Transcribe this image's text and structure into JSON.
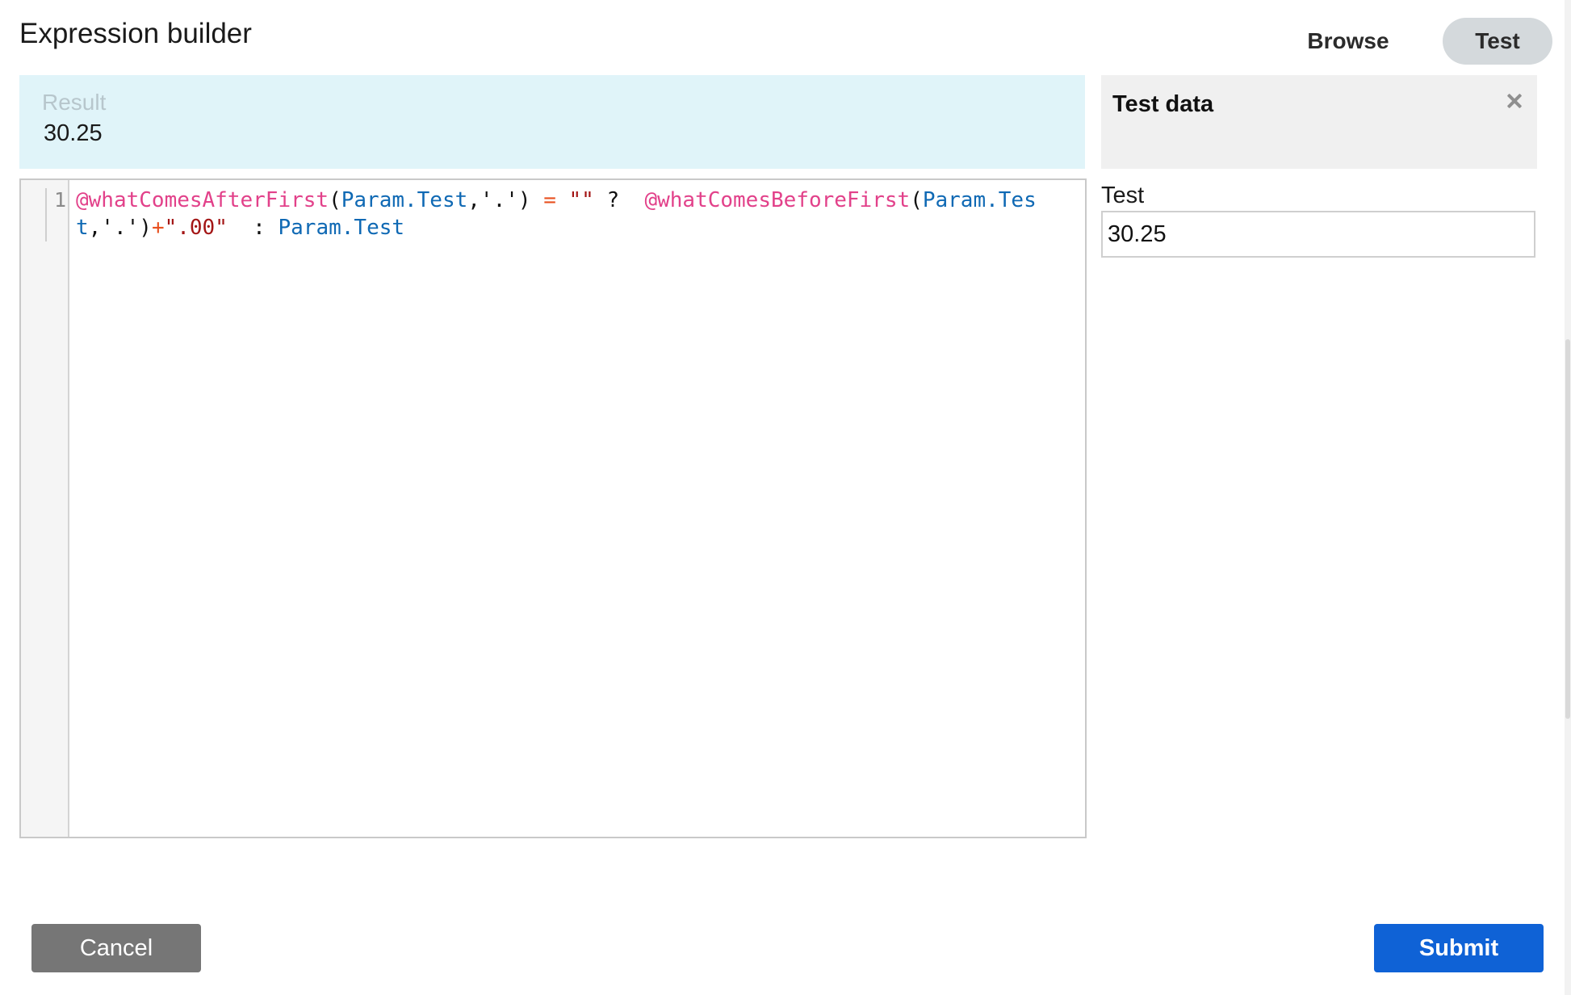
{
  "header": {
    "title": "Expression builder",
    "tabs": [
      {
        "label": "Browse",
        "active": false
      },
      {
        "label": "Test",
        "active": true
      }
    ]
  },
  "result": {
    "label": "Result",
    "value": "30.25"
  },
  "editor": {
    "line_number": "1",
    "tokens": [
      {
        "text": "@whatComesAfterFirst",
        "kind": "func"
      },
      {
        "text": "(",
        "kind": "plain"
      },
      {
        "text": "Param.Test",
        "kind": "param"
      },
      {
        "text": ",'.') ",
        "kind": "plain"
      },
      {
        "text": "=",
        "kind": "op"
      },
      {
        "text": " ",
        "kind": "plain"
      },
      {
        "text": "\"\"",
        "kind": "str"
      },
      {
        "text": " ?  ",
        "kind": "plain"
      },
      {
        "text": "@whatComesBeforeFirst",
        "kind": "func"
      },
      {
        "text": "(",
        "kind": "plain"
      },
      {
        "text": "Param.Test",
        "kind": "param"
      },
      {
        "text": ",'.')",
        "kind": "plain"
      },
      {
        "text": "+",
        "kind": "op"
      },
      {
        "text": "\".00\"",
        "kind": "str"
      },
      {
        "text": "  : ",
        "kind": "plain"
      },
      {
        "text": "Param.Test",
        "kind": "param"
      }
    ]
  },
  "test_data": {
    "title": "Test data",
    "close_icon": "close-icon",
    "field_label": "Test",
    "field_value": "30.25"
  },
  "footer": {
    "cancel_label": "Cancel",
    "submit_label": "Submit"
  },
  "colors": {
    "result_bg": "#e0f4f9",
    "active_tab_bg": "#d4d9dc",
    "submit_bg": "#0f62d6",
    "cancel_bg": "#767676",
    "func_token": "#e2418a",
    "param_token": "#0f69b4",
    "string_token": "#a31515",
    "operator_token": "#e8501f"
  }
}
